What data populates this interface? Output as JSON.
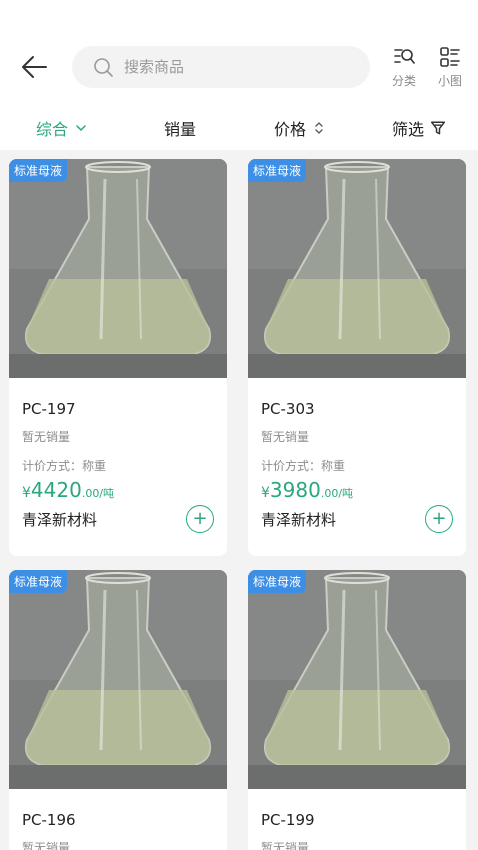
{
  "search": {
    "placeholder": "搜索商品"
  },
  "tools": {
    "category_label": "分类",
    "view_label": "小图"
  },
  "sort": {
    "overall": "综合",
    "sales": "销量",
    "price": "价格",
    "filter": "筛选"
  },
  "colors": {
    "accent": "#2aa77e",
    "badge": "#3d8fe6"
  },
  "products": [
    {
      "badge": "标准母液",
      "name": "PC-197",
      "sales": "暂无销量",
      "method": "计价方式：称重",
      "currency": "¥",
      "price": "4420",
      "unit": ".00/吨",
      "store": "青泽新材料"
    },
    {
      "badge": "标准母液",
      "name": "PC-303",
      "sales": "暂无销量",
      "method": "计价方式：称重",
      "currency": "¥",
      "price": "3980",
      "unit": ".00/吨",
      "store": "青泽新材料"
    },
    {
      "badge": "标准母液",
      "name": "PC-196",
      "sales": "暂无销量"
    },
    {
      "badge": "标准母液",
      "name": "PC-199",
      "sales": "暂无销量"
    }
  ]
}
